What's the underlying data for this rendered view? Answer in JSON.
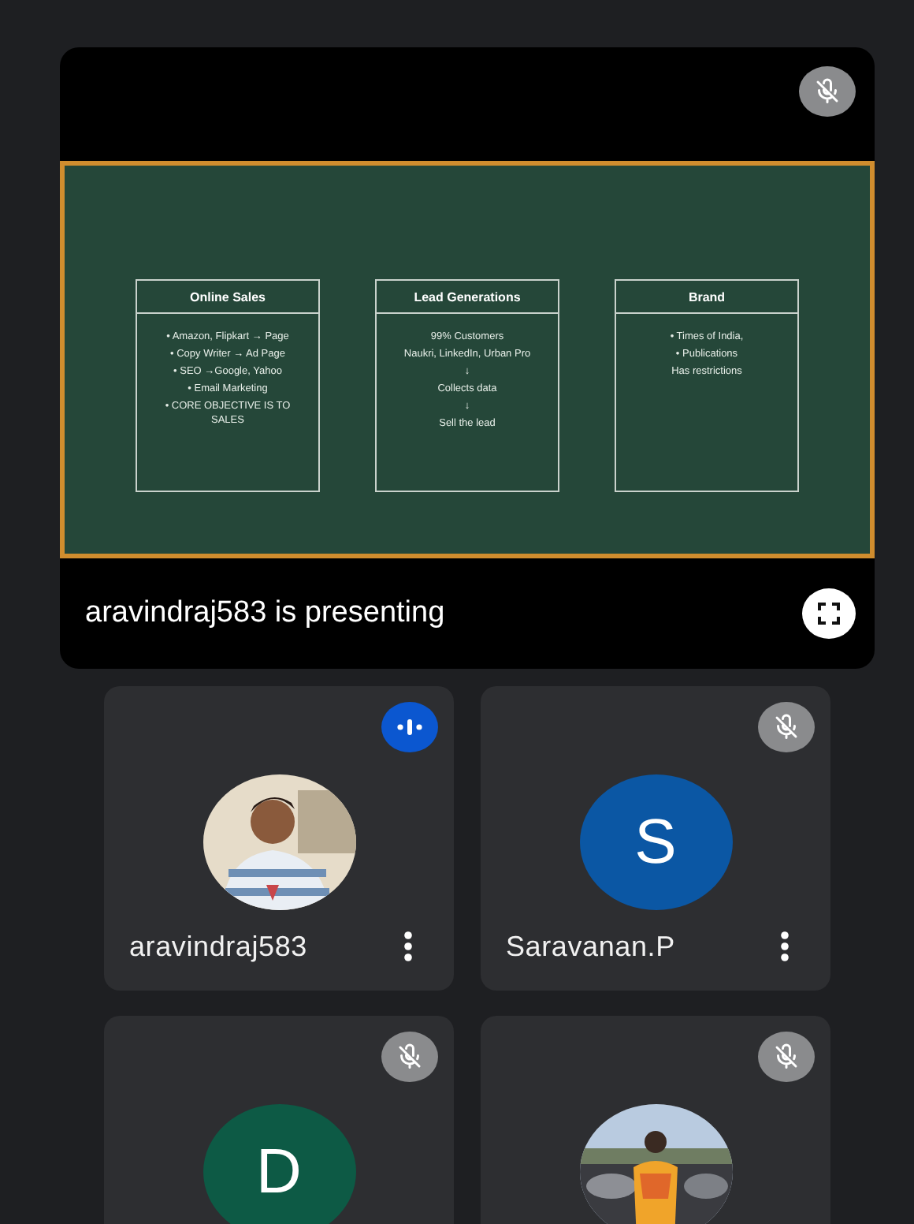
{
  "presentation": {
    "presenter_muted": true,
    "slide": {
      "columns": [
        {
          "title": "Online Sales",
          "lines": [
            "• Amazon, Flipkart → Page",
            "• Copy Writer → Ad Page",
            "• SEO →Google, Yahoo",
            "• Email Marketing",
            "• CORE OBJECTIVE IS TO SALES"
          ]
        },
        {
          "title": "Lead Generations",
          "lines": [
            "99% Customers",
            "Naukri, LinkedIn, Urban Pro",
            "↓",
            "Collects data",
            "↓",
            "Sell the lead"
          ]
        },
        {
          "title": "Brand",
          "lines": [
            "• Times of India,",
            "• Publications",
            "Has restrictions"
          ]
        }
      ]
    },
    "caption": "aravindraj583 is presenting"
  },
  "participants": [
    {
      "name": "aravindraj583",
      "speaking": true
    },
    {
      "name": "Saravanan.P",
      "muted": true,
      "avatar": {
        "kind": "letter",
        "letter": "S",
        "color": "#0b57a4"
      }
    },
    {
      "muted": true,
      "avatar": {
        "kind": "letter",
        "letter": "D",
        "color": "#0d5a45"
      }
    },
    {
      "muted": true
    }
  ]
}
